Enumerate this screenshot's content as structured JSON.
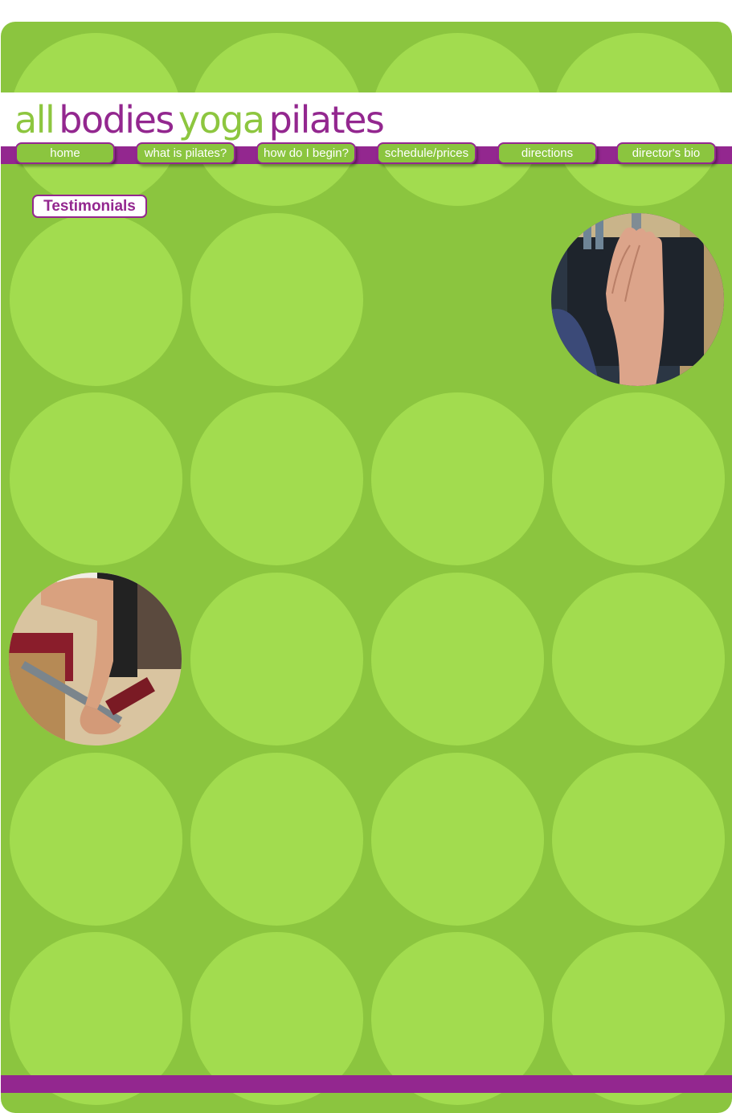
{
  "brand": {
    "logo_parts": [
      "all",
      "bodies",
      "yoga",
      "pilates"
    ],
    "colors": {
      "purple": "#93278f",
      "green": "#8bc53f",
      "light_green": "#a2dc4f",
      "logo_green": "#8dc63f"
    }
  },
  "nav": {
    "items": [
      {
        "label": "home"
      },
      {
        "label": "what is pilates?"
      },
      {
        "label": "how do I begin?"
      },
      {
        "label": "schedule/prices"
      },
      {
        "label": "directions"
      },
      {
        "label": "director's bio"
      }
    ]
  },
  "main": {
    "testimonials_label": "Testimonials"
  },
  "photos": [
    {
      "alt": "hand-on-reformer-photo"
    },
    {
      "alt": "feet-on-pilates-chair-photo"
    }
  ]
}
